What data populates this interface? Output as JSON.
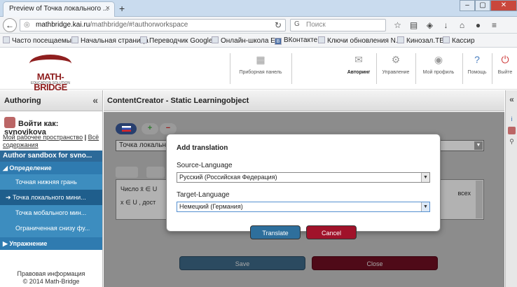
{
  "browser": {
    "tab_title": "Preview of Точка локального ...",
    "tab_close": "×",
    "new_tab": "+",
    "url_domain": "mathbridge.kai.ru",
    "url_path": "/mathbridge/#!authorworkspace",
    "search_placeholder": "Поиск",
    "window_buttons": [
      "–",
      "▢",
      "✕"
    ]
  },
  "bookmarks": [
    "Часто посещаемые",
    "Начальная страница",
    "Переводчик Google",
    "Онлайн-школа EF",
    "ВКонтакте",
    "Ключи обновления N...",
    "Кинозал.ТВ",
    "Кассир"
  ],
  "app": {
    "logo_text": "MATH-BRIDGE",
    "logo_sub": "EDUCATION SOLUTION",
    "nav": [
      {
        "label": "Приборная панель",
        "icon": "dashboard-icon"
      },
      {
        "label": "Авторинг",
        "icon": "authoring-icon"
      },
      {
        "label": "Управление",
        "icon": "management-icon"
      },
      {
        "label": "Мой профиль",
        "icon": "profile-icon"
      },
      {
        "label": "Помощь",
        "icon": "help-icon"
      },
      {
        "label": "Выйте",
        "icon": "logout-icon"
      }
    ]
  },
  "sidebar": {
    "title": "Authoring",
    "collapse": "«",
    "user": "Войти как: svnovikova",
    "link_workspace": "Мой рабочее пространство",
    "link_sep": " | ",
    "link_all": "Всё содержания",
    "sandbox": "Author sandbox for svno...",
    "category_definition": "Определение",
    "items": [
      "Точная нижняя грань",
      "Точка локального мини...",
      "Точка мобального мин...",
      "Ограниченная снизу фу..."
    ],
    "category_exercise": "Упражнение",
    "footer_line1": "Правовая информация",
    "footer_line2": "© 2014 Math-Bridge"
  },
  "main": {
    "title": "ContentCreator - Static Learningobject",
    "select_value": "Точка локально",
    "editor_line1": "Число x̄ ∈ U",
    "editor_line2": "x ∈ U , дост",
    "editor_right": "всех",
    "save_label": "Save",
    "close_label": "Close"
  },
  "dialog": {
    "title": "Add translation",
    "source_label": "Source-Language",
    "source_value": "Русский (Российская Федерация)",
    "target_label": "Target-Language",
    "target_value": "Немецкий (Германия)",
    "translate_label": "Translate",
    "cancel_label": "Cancel"
  },
  "colors": {
    "accent_blue": "#2d6a99",
    "translate_btn": "#2e6f9c",
    "cancel_btn": "#a0122a"
  }
}
